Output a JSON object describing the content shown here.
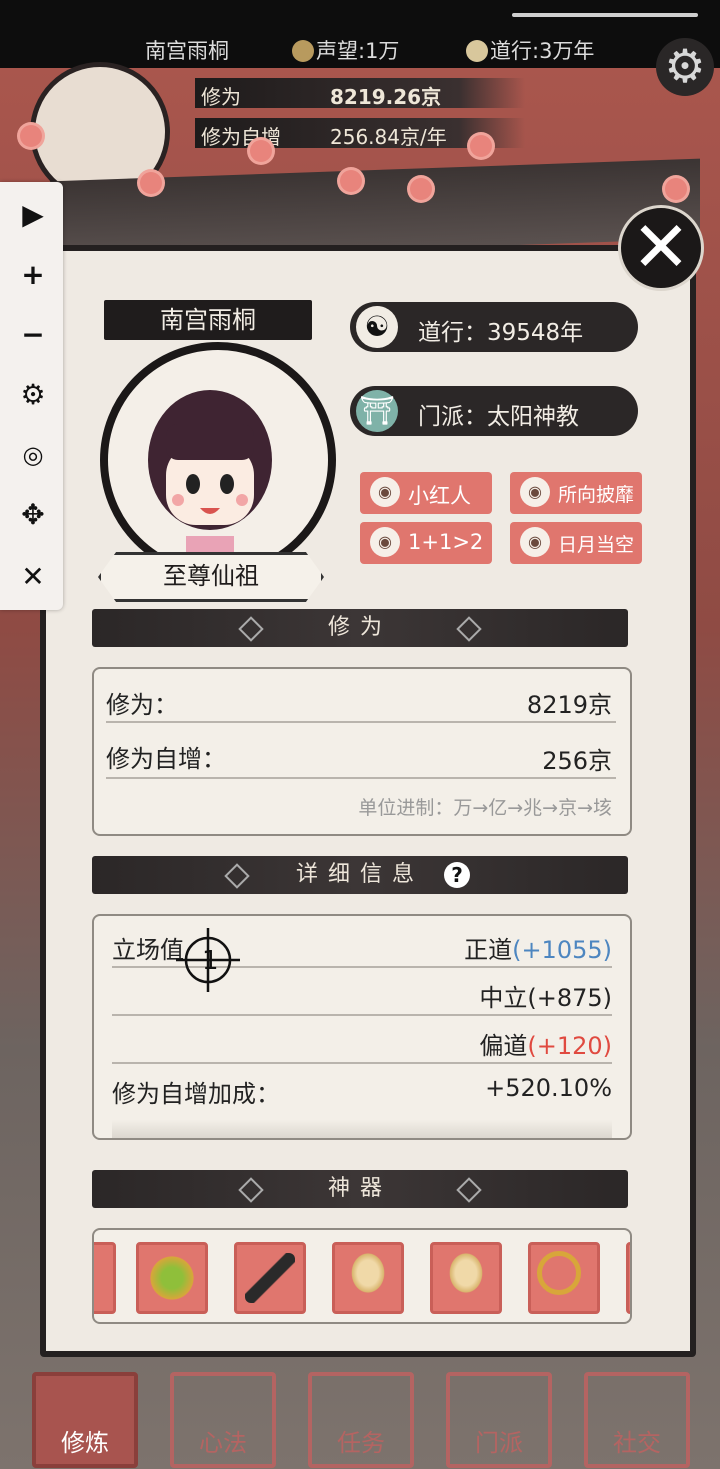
{
  "topbar": {
    "player_name": "南宫雨桐",
    "reputation": "声望:1万",
    "daoxing": "道行:3万年"
  },
  "header": {
    "cultivation_label": "修为",
    "cultivation_value": "8219.26京",
    "growth_label": "修为自增",
    "growth_value": "256.84京/年"
  },
  "profile": {
    "name": "南宫雨桐",
    "rank": "至尊仙祖",
    "daoxing": "道行：39548年",
    "sect": "门派：太阳神教",
    "tags": [
      "小红人",
      "所向披靡",
      "1+1>2",
      "日月当空"
    ]
  },
  "sections": {
    "cultivation_title": "修为",
    "detail_title": "详细信息",
    "artifact_title": "神器"
  },
  "cultivation": {
    "rows": [
      {
        "label": "修为：",
        "value": "8219京"
      },
      {
        "label": "修为自增：",
        "value": "256京"
      }
    ],
    "unit_note": "单位进制：万→亿→兆→京→垓"
  },
  "details": {
    "stance_label": "立场值",
    "stance_rows": [
      {
        "name": "正道",
        "delta": "(+1055)",
        "color": "#4d86c0"
      },
      {
        "name": "中立",
        "delta": "(+875)",
        "color": "#222222"
      },
      {
        "name": "偏道",
        "delta": "(+120)",
        "color": "#e04a40"
      }
    ],
    "bonus_label": "修为自增加成：",
    "bonus_value": "+520.10%",
    "crosshair_number": "1"
  },
  "artifacts": [
    "sun-gear-icon",
    "umbrella-icon",
    "golden-statue-icon",
    "golden-statue-icon",
    "whip-icon"
  ],
  "sidebar": [
    "play-icon",
    "plus-icon",
    "minus-icon",
    "gear-icon",
    "hide-eye-icon",
    "move-icon",
    "close-icon"
  ],
  "bottom_nav": [
    "修炼",
    "心法",
    "任务",
    "门派",
    "社交"
  ],
  "colors": {
    "accent": "#e0766e",
    "ink": "#1f1c1c",
    "paper": "#efeae3"
  }
}
